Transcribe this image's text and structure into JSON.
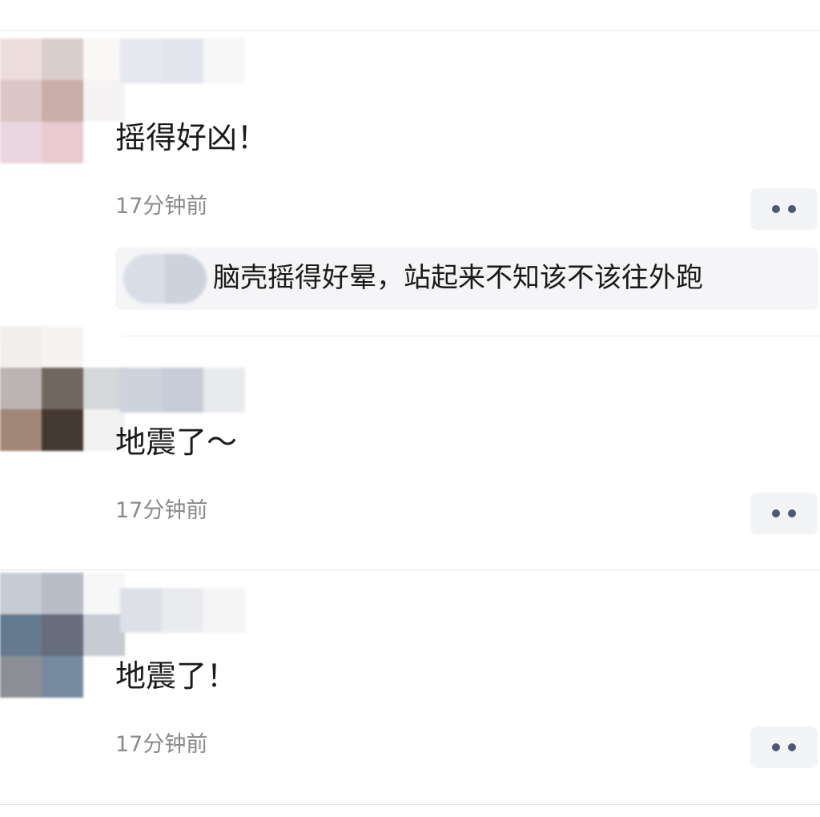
{
  "comments": [
    {
      "text": "摇得好凶！",
      "time": "17分钟前",
      "avatar_colors": [
        "#ecdcd9",
        "#d8ccc8",
        "#faf7f7",
        "#dcc3c3",
        "#c7a9a5",
        "#f5f3f3",
        "#e9d4de",
        "#e8c9cd",
        "#ffffff"
      ],
      "nickname_colors": [
        "#e6e8ee",
        "#e2e5ec",
        "#f7f7f8"
      ],
      "reply": {
        "text": "脑壳摇得好晕，站起来不知该不该往外跑",
        "avatar_colors": [
          "#d9dde5",
          "#cdd2dd"
        ]
      }
    },
    {
      "text": "地震了～",
      "time": "17分钟前",
      "avatar_colors": [
        "#f3eeee",
        "#f6f3f3",
        "#ffffff",
        "#b9afaf",
        "#6b5f58",
        "#d4d5d8",
        "#9b8171",
        "#3b2f26",
        "#f1f1f1"
      ],
      "nickname_colors": [
        "#cdd2dc",
        "#c8ccd8",
        "#e9eaee"
      ]
    },
    {
      "text": "地震了！",
      "time": "17分钟前",
      "avatar_colors": [
        "#c3cad3",
        "#b4b9c4",
        "#f7f7f7",
        "#5d7389",
        "#5f6676",
        "#c3c9d2",
        "#858a90",
        "#6f849b",
        "#ffffff"
      ],
      "nickname_colors": [
        "#dde1e7",
        "#e9ebee",
        "#f5f5f6"
      ]
    }
  ],
  "colors": {
    "divider": "#e6e6e6",
    "timestamp": "#8a8a8a",
    "more_button_bg": "#f3f4f6",
    "more_button_dots": "#4d5a73",
    "reply_bg": "#f5f5f7"
  },
  "icons": {
    "more": "more-dots-icon"
  }
}
